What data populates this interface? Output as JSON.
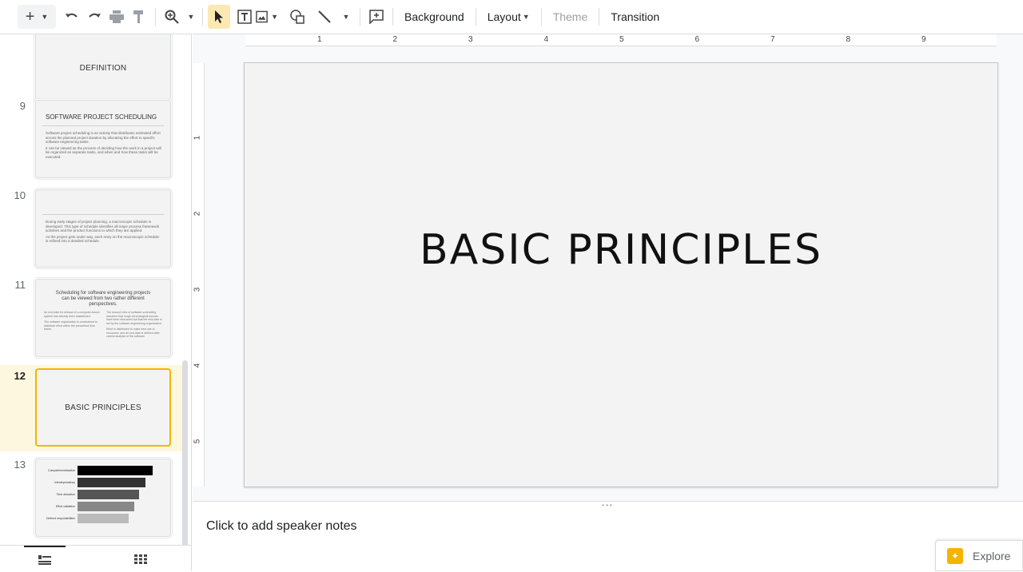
{
  "toolbar": {
    "background_label": "Background",
    "layout_label": "Layout",
    "theme_label": "Theme",
    "transition_label": "Transition"
  },
  "filmstrip": {
    "slides": [
      {
        "number": "",
        "title": "DEFINITION"
      },
      {
        "number": "9",
        "title": "SOFTWARE PROJECT SCHEDULING",
        "body": [
          "Software project scheduling is an activity that distributes estimated effort across the planned project duration by allocating the effort to specific software engineering tasks.",
          "It can be viewed as the process of deciding how the work in a project will be organized as separate tasks, and when and how these tasks will be executed."
        ]
      },
      {
        "number": "10",
        "title": "",
        "body": [
          "During early stages of project planning, a macroscopic schedule is developed. This type of schedule identifies all major process framework activities and the product functions to which they are applied.",
          "As the project gets under way, each entry on the macroscopic schedule is refined into a detailed schedule."
        ]
      },
      {
        "number": "11",
        "title": "Scheduling for software engineering projects can be viewed from two rather different perspectives.",
        "col1": [
          "An end-date for release of a computer-based system has already been established.",
          "The software organization is constrained to distribute effort within the prescribed time frame."
        ],
        "col2": [
          "The second view of software scheduling assumes that rough chronological bounds have been discussed but that the end-date is set by the software engineering organization.",
          "Effort is distributed to make best use of resources, and an end-date is defined after careful analysis of the software."
        ]
      },
      {
        "number": "12",
        "title": "BASIC PRINCIPLES"
      },
      {
        "number": "13",
        "bars": [
          {
            "label": "Compartmentalization",
            "value": 1.0
          },
          {
            "label": "Interdependency",
            "value": 0.9
          },
          {
            "label": "Time allocation",
            "value": 0.82
          },
          {
            "label": "Effort validation",
            "value": 0.76
          },
          {
            "label": "Defined responsibilities",
            "value": 0.68
          }
        ]
      }
    ]
  },
  "ruler": {
    "top": [
      "1",
      "2",
      "3",
      "4",
      "5",
      "6",
      "7",
      "8",
      "9"
    ],
    "left": [
      "1",
      "2",
      "3",
      "4",
      "5"
    ]
  },
  "slide": {
    "title": "BASIC PRINCIPLES"
  },
  "notes": {
    "placeholder": "Click to add speaker notes"
  },
  "explore": {
    "label": "Explore"
  },
  "colors": {
    "active_accent": "#f4b400",
    "active_row_bg": "#fef7e0",
    "explore_icon": "#f4b400"
  }
}
